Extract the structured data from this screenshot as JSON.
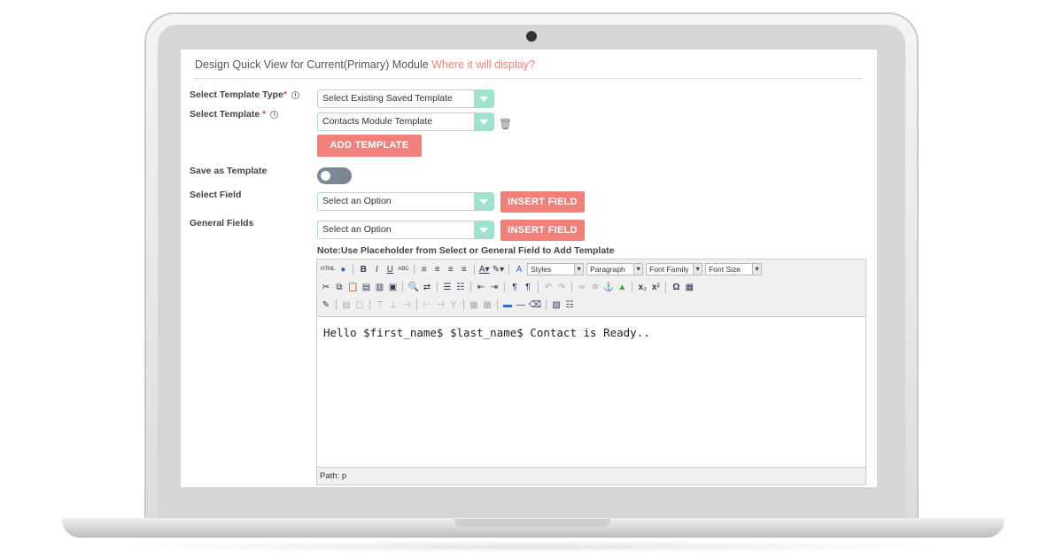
{
  "header": {
    "title": "Design Quick View for Current(Primary) Module",
    "link": "Where it will display?"
  },
  "form": {
    "template_type": {
      "label": "Select Template Type",
      "required": "*",
      "value": "Select Existing Saved Template"
    },
    "template": {
      "label": "Select Template",
      "required": "*",
      "value": "Contacts Module Template"
    },
    "add_template": "ADD TEMPLATE",
    "save_as_template": {
      "label": "Save as Template",
      "enabled": false
    },
    "select_field": {
      "label": "Select Field",
      "value": "Select an Option",
      "button": "INSERT FIELD"
    },
    "general_fields": {
      "label": "General Fields",
      "value": "Select an Option",
      "button": "INSERT FIELD"
    },
    "note": "Note:Use Placeholder from Select or General Field to Add Template"
  },
  "editor": {
    "dropdowns": [
      "Styles",
      "Paragraph",
      "Font Family",
      "Font Size"
    ],
    "content": "Hello $first_name$ $last_name$ Contact is Ready..",
    "path": "Path: p"
  },
  "colors": {
    "accent": "#f0807a",
    "select_border": "#9fe3cf",
    "toggle_off": "#7b8794"
  }
}
